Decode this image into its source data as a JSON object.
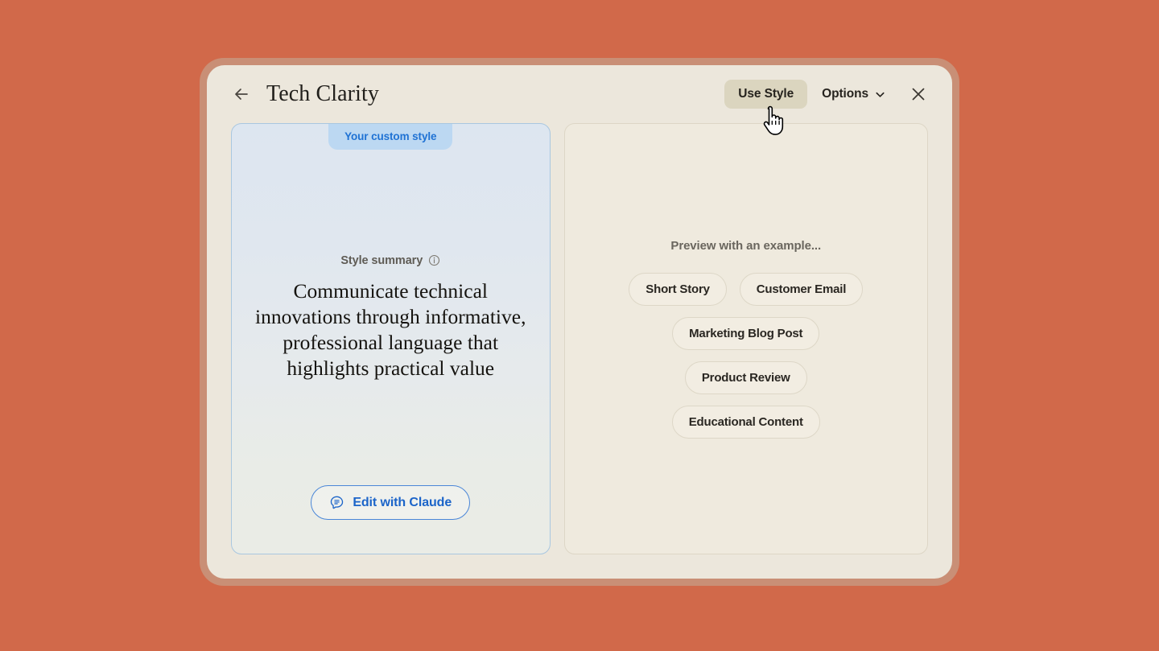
{
  "window": {
    "title": "Tech Clarity",
    "back_icon": "arrow-left-icon",
    "close_icon": "close-icon",
    "frame_color": "#c98f76",
    "backdrop_color": "#d1694a",
    "surface_color": "#ece7dc"
  },
  "header": {
    "use_style_label": "Use Style",
    "use_style_bg": "#dbd5bf",
    "options_label": "Options",
    "chevron_icon": "chevron-down-icon"
  },
  "left_panel": {
    "badge_label": "Your custom style",
    "badge_bg": "#bcd8f2",
    "badge_color": "#1f72d4",
    "summary_label": "Style summary",
    "info_icon": "info-icon",
    "summary_text": "Communicate technical innovations through informative, professional language that highlights practical value",
    "edit_button_label": "Edit with Claude",
    "edit_button_icon": "claude-chat-icon",
    "edit_button_color": "#1b64c9",
    "border_color": "#a9c7e0"
  },
  "right_panel": {
    "preview_label": "Preview with an example...",
    "examples": [
      "Short Story",
      "Customer Email",
      "Marketing Blog Post",
      "Product Review",
      "Educational Content"
    ],
    "pill_bg": "#f2ede2",
    "background": "#efeade"
  },
  "cursor": {
    "type": "pointer-hand-cursor"
  }
}
